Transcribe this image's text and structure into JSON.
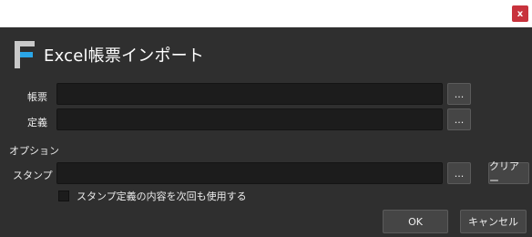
{
  "window": {
    "close_glyph": "x"
  },
  "header": {
    "title": "Excel帳票インポート",
    "logo_icon": "f-logo-icon"
  },
  "form": {
    "report_label": "帳票",
    "report_value": "",
    "definition_label": "定義",
    "definition_value": "",
    "options_heading": "オプション",
    "stamp_label": "スタンプ",
    "stamp_value": "",
    "browse_label": "...",
    "clear_label": "クリアー",
    "reuse_checkbox_label": "スタンプ定義の内容を次回も使用する",
    "reuse_checked": false
  },
  "footer": {
    "ok_label": "OK",
    "cancel_label": "キャンセル"
  },
  "colors": {
    "background": "#2f2f2f",
    "field": "#1c1c1c",
    "button": "#454545",
    "accent": "#2aa6e8",
    "close": "#c8323c"
  }
}
